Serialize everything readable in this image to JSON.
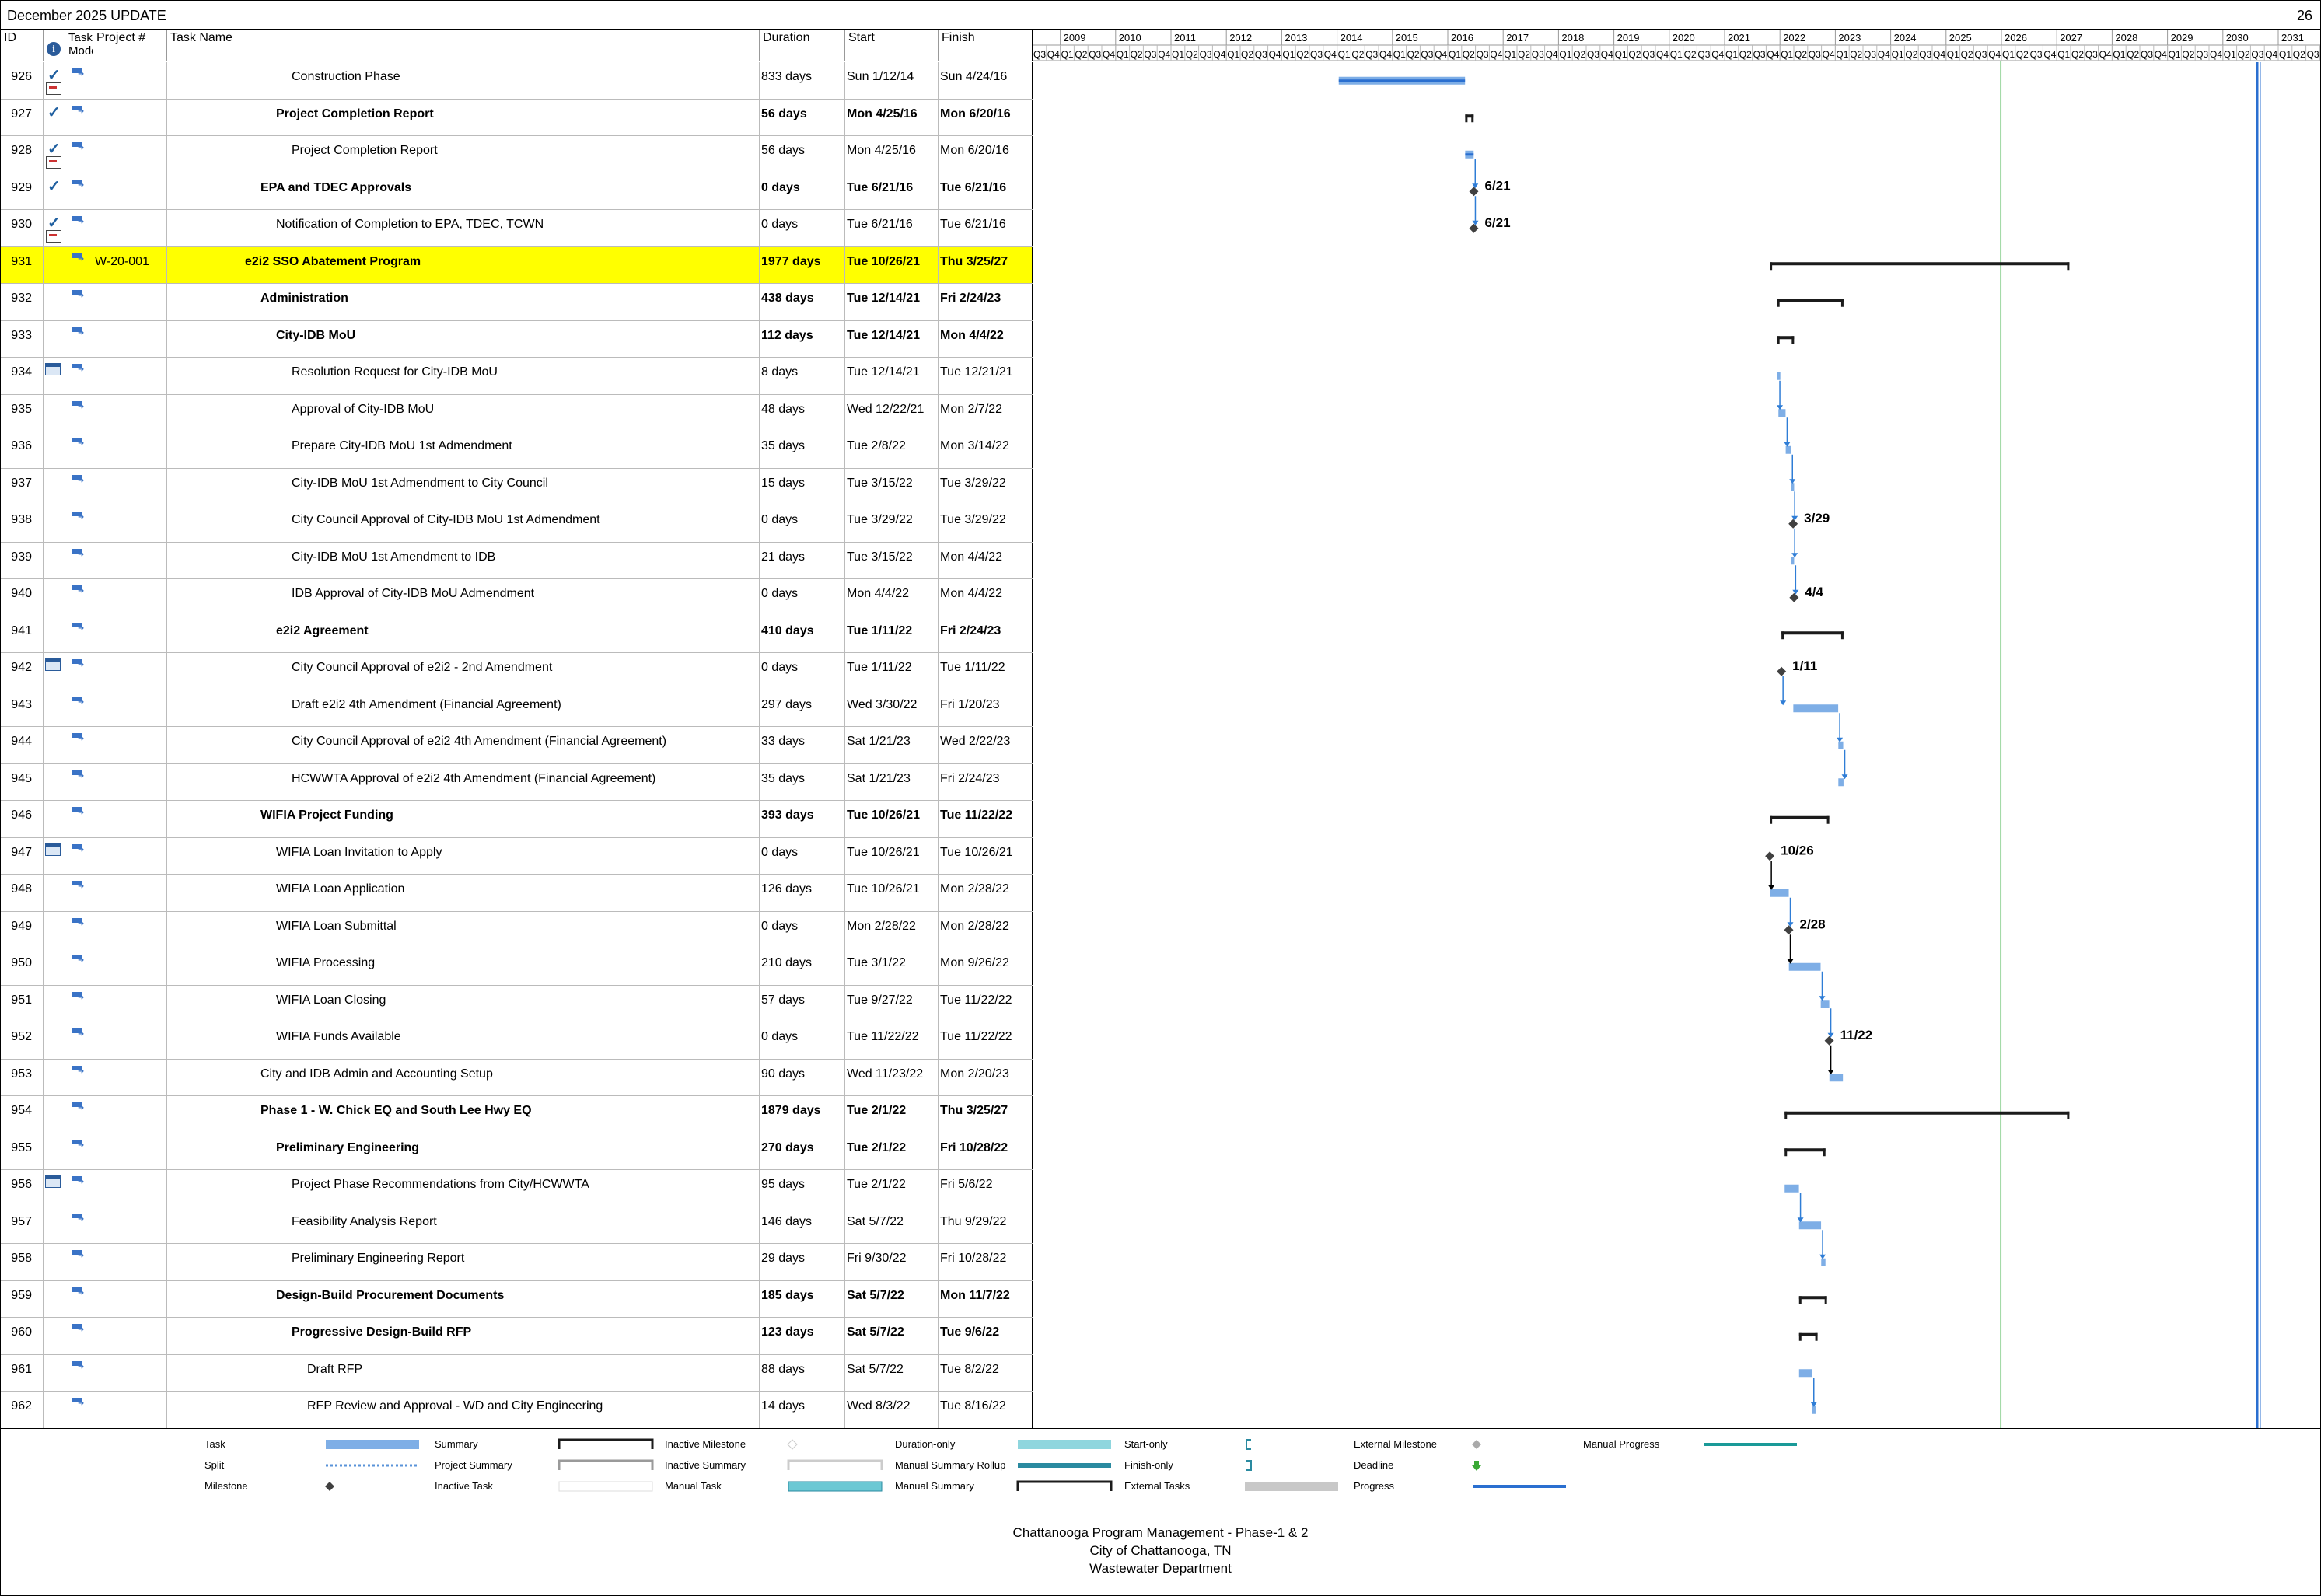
{
  "header": {
    "title": "December 2025 UPDATE",
    "page": "26"
  },
  "columns": {
    "id": "ID",
    "indicators_icon": "info-icon",
    "task_mode": "Task Mode",
    "project": "Project #",
    "name": "Task Name",
    "duration": "Duration",
    "start": "Start",
    "finish": "Finish"
  },
  "timeline": {
    "years": [
      "2009",
      "2010",
      "2011",
      "2012",
      "2013",
      "2014",
      "2015",
      "2016",
      "2017",
      "2018",
      "2019",
      "2020",
      "2021",
      "2022",
      "2023",
      "2024",
      "2025",
      "2026",
      "2027",
      "2028",
      "2029",
      "2030",
      "2031"
    ],
    "quarters": [
      "Q1",
      "Q2",
      "Q3",
      "Q4"
    ],
    "first_quarter_label": "Q3",
    "status_date_line": "2026",
    "colors": {
      "task": "#7eaee6",
      "summary": "#1b1b1b",
      "milestone": "#404040",
      "link": "#2f7dd6",
      "link_black": "#000000",
      "status_line": "#3cb043",
      "progress": "#2a6fd0"
    }
  },
  "rows": [
    {
      "id": "926",
      "done": true,
      "note": true,
      "cal": false,
      "proj": "",
      "name": "Construction Phase",
      "level": 3,
      "bold": false,
      "dur": "833 days",
      "start": "Sun 1/12/14",
      "finish": "Sun 4/24/16",
      "kind": "task",
      "s": "2014-01-12",
      "f": "2016-04-24"
    },
    {
      "id": "927",
      "done": true,
      "note": false,
      "cal": false,
      "proj": "",
      "name": "Project Completion Report",
      "level": 2,
      "bold": true,
      "dur": "56 days",
      "start": "Mon 4/25/16",
      "finish": "Mon 6/20/16",
      "kind": "summary",
      "s": "2016-04-25",
      "f": "2016-06-20"
    },
    {
      "id": "928",
      "done": true,
      "note": true,
      "cal": false,
      "proj": "",
      "name": "Project Completion Report",
      "level": 3,
      "bold": false,
      "dur": "56 days",
      "start": "Mon 4/25/16",
      "finish": "Mon 6/20/16",
      "kind": "task",
      "s": "2016-04-25",
      "f": "2016-06-20"
    },
    {
      "id": "929",
      "done": true,
      "note": false,
      "cal": false,
      "proj": "",
      "name": "EPA and TDEC Approvals",
      "level": 1,
      "bold": true,
      "dur": "0 days",
      "start": "Tue 6/21/16",
      "finish": "Tue 6/21/16",
      "kind": "milestone",
      "s": "2016-06-21",
      "f": "2016-06-21",
      "mlabel": "6/21"
    },
    {
      "id": "930",
      "done": true,
      "note": true,
      "cal": false,
      "proj": "",
      "name": "Notification of Completion to EPA, TDEC, TCWN",
      "level": 2,
      "bold": false,
      "dur": "0 days",
      "start": "Tue 6/21/16",
      "finish": "Tue 6/21/16",
      "kind": "milestone",
      "s": "2016-06-21",
      "f": "2016-06-21",
      "mlabel": "6/21"
    },
    {
      "id": "931",
      "done": false,
      "note": false,
      "cal": false,
      "proj": "W-20-001",
      "name": "e2i2 SSO Abatement Program",
      "level": 0,
      "bold": true,
      "dur": "1977 days",
      "start": "Tue 10/26/21",
      "finish": "Thu 3/25/27",
      "kind": "summary",
      "s": "2021-10-26",
      "f": "2027-03-25",
      "hl": true
    },
    {
      "id": "932",
      "done": false,
      "note": false,
      "cal": false,
      "proj": "",
      "name": "Administration",
      "level": 1,
      "bold": true,
      "dur": "438 days",
      "start": "Tue 12/14/21",
      "finish": "Fri 2/24/23",
      "kind": "summary",
      "s": "2021-12-14",
      "f": "2023-02-24"
    },
    {
      "id": "933",
      "done": false,
      "note": false,
      "cal": false,
      "proj": "",
      "name": "City-IDB MoU",
      "level": 2,
      "bold": true,
      "dur": "112 days",
      "start": "Tue 12/14/21",
      "finish": "Mon 4/4/22",
      "kind": "summary",
      "s": "2021-12-14",
      "f": "2022-04-04"
    },
    {
      "id": "934",
      "done": false,
      "note": false,
      "cal": true,
      "proj": "",
      "name": "Resolution Request for City-IDB MoU",
      "level": 3,
      "bold": false,
      "dur": "8 days",
      "start": "Tue 12/14/21",
      "finish": "Tue 12/21/21",
      "kind": "task",
      "s": "2021-12-14",
      "f": "2021-12-21"
    },
    {
      "id": "935",
      "done": false,
      "note": false,
      "cal": false,
      "proj": "",
      "name": "Approval of City-IDB MoU",
      "level": 3,
      "bold": false,
      "dur": "48 days",
      "start": "Wed 12/22/21",
      "finish": "Mon 2/7/22",
      "kind": "task",
      "s": "2021-12-22",
      "f": "2022-02-07"
    },
    {
      "id": "936",
      "done": false,
      "note": false,
      "cal": false,
      "proj": "",
      "name": "Prepare City-IDB MoU 1st Admendment",
      "level": 3,
      "bold": false,
      "dur": "35 days",
      "start": "Tue 2/8/22",
      "finish": "Mon 3/14/22",
      "kind": "task",
      "s": "2022-02-08",
      "f": "2022-03-14"
    },
    {
      "id": "937",
      "done": false,
      "note": false,
      "cal": false,
      "proj": "",
      "name": "City-IDB MoU 1st Admendment to City Council",
      "level": 3,
      "bold": false,
      "dur": "15 days",
      "start": "Tue 3/15/22",
      "finish": "Tue 3/29/22",
      "kind": "task",
      "s": "2022-03-15",
      "f": "2022-03-29"
    },
    {
      "id": "938",
      "done": false,
      "note": false,
      "cal": false,
      "proj": "",
      "name": "City Council Approval of City-IDB MoU 1st Admendment",
      "level": 3,
      "bold": false,
      "dur": "0 days",
      "start": "Tue 3/29/22",
      "finish": "Tue 3/29/22",
      "kind": "milestone",
      "s": "2022-03-29",
      "f": "2022-03-29",
      "mlabel": "3/29"
    },
    {
      "id": "939",
      "done": false,
      "note": false,
      "cal": false,
      "proj": "",
      "name": "City-IDB MoU 1st Amendment to IDB",
      "level": 3,
      "bold": false,
      "dur": "21 days",
      "start": "Tue 3/15/22",
      "finish": "Mon 4/4/22",
      "kind": "task",
      "s": "2022-03-15",
      "f": "2022-04-04"
    },
    {
      "id": "940",
      "done": false,
      "note": false,
      "cal": false,
      "proj": "",
      "name": "IDB Approval of City-IDB MoU Admendment",
      "level": 3,
      "bold": false,
      "dur": "0 days",
      "start": "Mon 4/4/22",
      "finish": "Mon 4/4/22",
      "kind": "milestone",
      "s": "2022-04-04",
      "f": "2022-04-04",
      "mlabel": "4/4"
    },
    {
      "id": "941",
      "done": false,
      "note": false,
      "cal": false,
      "proj": "",
      "name": "e2i2 Agreement",
      "level": 2,
      "bold": true,
      "dur": "410 days",
      "start": "Tue 1/11/22",
      "finish": "Fri 2/24/23",
      "kind": "summary",
      "s": "2022-01-11",
      "f": "2023-02-24"
    },
    {
      "id": "942",
      "done": false,
      "note": false,
      "cal": true,
      "proj": "",
      "name": "City Council Approval of e2i2 - 2nd Amendment",
      "level": 3,
      "bold": false,
      "dur": "0 days",
      "start": "Tue 1/11/22",
      "finish": "Tue 1/11/22",
      "kind": "milestone",
      "s": "2022-01-11",
      "f": "2022-01-11",
      "mlabel": "1/11"
    },
    {
      "id": "943",
      "done": false,
      "note": false,
      "cal": false,
      "proj": "",
      "name": "Draft e2i2 4th Amendment (Financial Agreement)",
      "level": 3,
      "bold": false,
      "dur": "297 days",
      "start": "Wed 3/30/22",
      "finish": "Fri 1/20/23",
      "kind": "task",
      "s": "2022-03-30",
      "f": "2023-01-20"
    },
    {
      "id": "944",
      "done": false,
      "note": false,
      "cal": false,
      "proj": "",
      "name": "City Council Approval of e2i2 4th Amendment (Financial Agreement)",
      "level": 3,
      "bold": false,
      "dur": "33 days",
      "start": "Sat 1/21/23",
      "finish": "Wed 2/22/23",
      "kind": "task",
      "s": "2023-01-21",
      "f": "2023-02-22"
    },
    {
      "id": "945",
      "done": false,
      "note": false,
      "cal": false,
      "proj": "",
      "name": "HCWWTA Approval of e2i2 4th Amendment (Financial Agreement)",
      "level": 3,
      "bold": false,
      "dur": "35 days",
      "start": "Sat 1/21/23",
      "finish": "Fri 2/24/23",
      "kind": "task",
      "s": "2023-01-21",
      "f": "2023-02-24"
    },
    {
      "id": "946",
      "done": false,
      "note": false,
      "cal": false,
      "proj": "",
      "name": "WIFIA Project Funding",
      "level": 1,
      "bold": true,
      "dur": "393 days",
      "start": "Tue 10/26/21",
      "finish": "Tue 11/22/22",
      "kind": "summary",
      "s": "2021-10-26",
      "f": "2022-11-22"
    },
    {
      "id": "947",
      "done": false,
      "note": false,
      "cal": true,
      "proj": "",
      "name": "WIFIA Loan Invitation to Apply",
      "level": 2,
      "bold": false,
      "dur": "0 days",
      "start": "Tue 10/26/21",
      "finish": "Tue 10/26/21",
      "kind": "milestone",
      "s": "2021-10-26",
      "f": "2021-10-26",
      "mlabel": "10/26"
    },
    {
      "id": "948",
      "done": false,
      "note": false,
      "cal": false,
      "proj": "",
      "name": "WIFIA Loan Application",
      "level": 2,
      "bold": false,
      "dur": "126 days",
      "start": "Tue 10/26/21",
      "finish": "Mon 2/28/22",
      "kind": "task",
      "s": "2021-10-26",
      "f": "2022-02-28"
    },
    {
      "id": "949",
      "done": false,
      "note": false,
      "cal": false,
      "proj": "",
      "name": "WIFIA Loan Submittal",
      "level": 2,
      "bold": false,
      "dur": "0 days",
      "start": "Mon 2/28/22",
      "finish": "Mon 2/28/22",
      "kind": "milestone",
      "s": "2022-02-28",
      "f": "2022-02-28",
      "mlabel": "2/28"
    },
    {
      "id": "950",
      "done": false,
      "note": false,
      "cal": false,
      "proj": "",
      "name": "WIFIA Processing",
      "level": 2,
      "bold": false,
      "dur": "210 days",
      "start": "Tue 3/1/22",
      "finish": "Mon 9/26/22",
      "kind": "task",
      "s": "2022-03-01",
      "f": "2022-09-26"
    },
    {
      "id": "951",
      "done": false,
      "note": false,
      "cal": false,
      "proj": "",
      "name": "WIFIA Loan Closing",
      "level": 2,
      "bold": false,
      "dur": "57 days",
      "start": "Tue 9/27/22",
      "finish": "Tue 11/22/22",
      "kind": "task",
      "s": "2022-09-27",
      "f": "2022-11-22"
    },
    {
      "id": "952",
      "done": false,
      "note": false,
      "cal": false,
      "proj": "",
      "name": "WIFIA Funds Available",
      "level": 2,
      "bold": false,
      "dur": "0 days",
      "start": "Tue 11/22/22",
      "finish": "Tue 11/22/22",
      "kind": "milestone",
      "s": "2022-11-22",
      "f": "2022-11-22",
      "mlabel": "11/22"
    },
    {
      "id": "953",
      "done": false,
      "note": false,
      "cal": false,
      "proj": "",
      "name": "City and IDB Admin and Accounting Setup",
      "level": 1,
      "bold": false,
      "dur": "90 days",
      "start": "Wed 11/23/22",
      "finish": "Mon 2/20/23",
      "kind": "task",
      "s": "2022-11-23",
      "f": "2023-02-20"
    },
    {
      "id": "954",
      "done": false,
      "note": false,
      "cal": false,
      "proj": "",
      "name": "Phase 1 - W. Chick EQ and South Lee Hwy EQ",
      "level": 1,
      "bold": true,
      "dur": "1879 days",
      "start": "Tue 2/1/22",
      "finish": "Thu 3/25/27",
      "kind": "summary",
      "s": "2022-02-01",
      "f": "2027-03-25"
    },
    {
      "id": "955",
      "done": false,
      "note": false,
      "cal": false,
      "proj": "",
      "name": "Preliminary Engineering",
      "level": 2,
      "bold": true,
      "dur": "270 days",
      "start": "Tue 2/1/22",
      "finish": "Fri 10/28/22",
      "kind": "summary",
      "s": "2022-02-01",
      "f": "2022-10-28"
    },
    {
      "id": "956",
      "done": false,
      "note": false,
      "cal": true,
      "proj": "",
      "name": "Project Phase Recommendations from City/HCWWTA",
      "level": 3,
      "bold": false,
      "dur": "95 days",
      "start": "Tue 2/1/22",
      "finish": "Fri 5/6/22",
      "kind": "task",
      "s": "2022-02-01",
      "f": "2022-05-06"
    },
    {
      "id": "957",
      "done": false,
      "note": false,
      "cal": false,
      "proj": "",
      "name": "Feasibility Analysis Report",
      "level": 3,
      "bold": false,
      "dur": "146 days",
      "start": "Sat 5/7/22",
      "finish": "Thu 9/29/22",
      "kind": "task",
      "s": "2022-05-07",
      "f": "2022-09-29"
    },
    {
      "id": "958",
      "done": false,
      "note": false,
      "cal": false,
      "proj": "",
      "name": "Preliminary Engineering Report",
      "level": 3,
      "bold": false,
      "dur": "29 days",
      "start": "Fri 9/30/22",
      "finish": "Fri 10/28/22",
      "kind": "task",
      "s": "2022-09-30",
      "f": "2022-10-28"
    },
    {
      "id": "959",
      "done": false,
      "note": false,
      "cal": false,
      "proj": "",
      "name": "Design-Build Procurement Documents",
      "level": 2,
      "bold": true,
      "dur": "185 days",
      "start": "Sat 5/7/22",
      "finish": "Mon 11/7/22",
      "kind": "summary",
      "s": "2022-05-07",
      "f": "2022-11-07"
    },
    {
      "id": "960",
      "done": false,
      "note": false,
      "cal": false,
      "proj": "",
      "name": "Progressive Design-Build RFP",
      "level": 3,
      "bold": true,
      "dur": "123 days",
      "start": "Sat 5/7/22",
      "finish": "Tue 9/6/22",
      "kind": "summary",
      "s": "2022-05-07",
      "f": "2022-09-06"
    },
    {
      "id": "961",
      "done": false,
      "note": false,
      "cal": false,
      "proj": "",
      "name": "Draft RFP",
      "level": 4,
      "bold": false,
      "dur": "88 days",
      "start": "Sat 5/7/22",
      "finish": "Tue 8/2/22",
      "kind": "task",
      "s": "2022-05-07",
      "f": "2022-08-02"
    },
    {
      "id": "962",
      "done": false,
      "note": false,
      "cal": false,
      "proj": "",
      "name": "RFP Review and Approval - WD and City Engineering",
      "level": 4,
      "bold": false,
      "dur": "14 days",
      "start": "Wed 8/3/22",
      "finish": "Tue 8/16/22",
      "kind": "task",
      "s": "2022-08-03",
      "f": "2022-08-16"
    }
  ],
  "legend": [
    {
      "label": "Task",
      "symbol": "task"
    },
    {
      "label": "Split",
      "symbol": "split"
    },
    {
      "label": "Milestone",
      "symbol": "milestone"
    },
    {
      "label": "Summary",
      "symbol": "summary"
    },
    {
      "label": "Project Summary",
      "symbol": "project-summary"
    },
    {
      "label": "Inactive Task",
      "symbol": "inactive-task"
    },
    {
      "label": "Inactive Milestone",
      "symbol": "inactive-milestone"
    },
    {
      "label": "Inactive Summary",
      "symbol": "inactive-summary"
    },
    {
      "label": "Manual Task",
      "symbol": "manual-task"
    },
    {
      "label": "Duration-only",
      "symbol": "duration-only"
    },
    {
      "label": "Manual Summary Rollup",
      "symbol": "manual-summary-rollup"
    },
    {
      "label": "Manual Summary",
      "symbol": "manual-summary"
    },
    {
      "label": "Start-only",
      "symbol": "start-only"
    },
    {
      "label": "Finish-only",
      "symbol": "finish-only"
    },
    {
      "label": "External Tasks",
      "symbol": "external-tasks"
    },
    {
      "label": "External Milestone",
      "symbol": "external-milestone"
    },
    {
      "label": "Deadline",
      "symbol": "deadline"
    },
    {
      "label": "Progress",
      "symbol": "progress"
    },
    {
      "label": "Manual Progress",
      "symbol": "manual-progress"
    }
  ],
  "footer": {
    "line1": "Chattanooga Program Management - Phase-1 & 2",
    "line2": "City of Chattanooga, TN",
    "line3": "Wastewater Department"
  }
}
